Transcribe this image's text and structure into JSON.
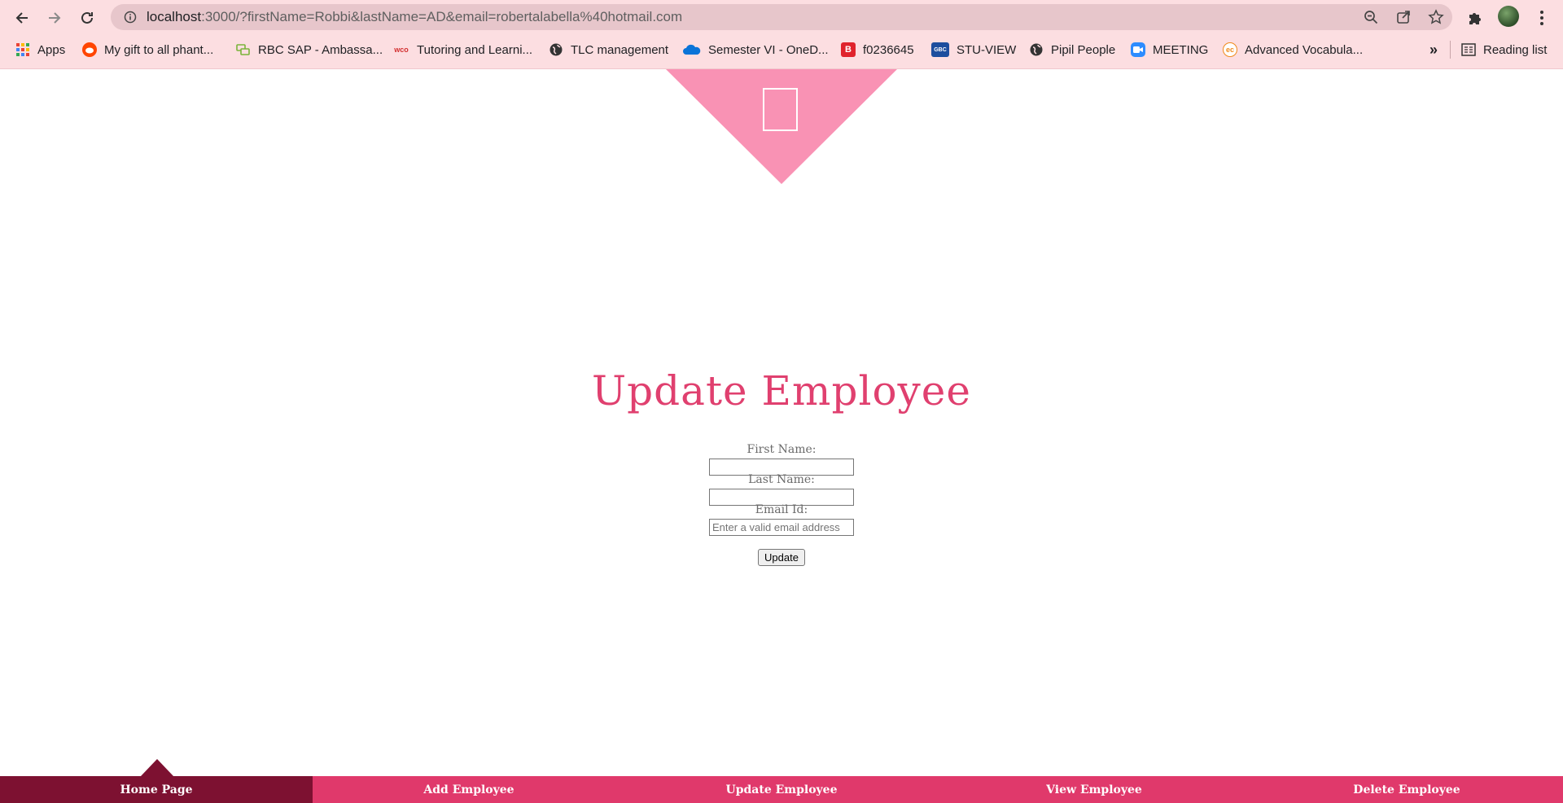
{
  "browser": {
    "url_host": "localhost",
    "url_rest": ":3000/?firstName=Robbi&lastName=AD&email=robertalabella%40hotmail.com",
    "bookmarks": [
      {
        "label": "Apps",
        "icon": "apps-grid-icon"
      },
      {
        "label": "My gift to all phant...",
        "icon": "reddit-icon"
      },
      {
        "label": "RBC SAP - Ambassa...",
        "icon": "chat-icon"
      },
      {
        "label": "Tutoring and Learni...",
        "icon": "wco-icon",
        "icon_text": "wco"
      },
      {
        "label": "TLC management",
        "icon": "globe-icon"
      },
      {
        "label": "Semester VI - OneD...",
        "icon": "onedrive-icon"
      },
      {
        "label": "f0236645",
        "icon": "b-icon",
        "icon_text": "B"
      },
      {
        "label": "STU-VIEW",
        "icon": "gbc-icon",
        "icon_text": "GBC"
      },
      {
        "label": "Pipil People",
        "icon": "globe-icon"
      },
      {
        "label": "MEETING",
        "icon": "zoom-icon"
      },
      {
        "label": "Advanced Vocabula...",
        "icon": "ec-icon",
        "icon_text": "ec"
      }
    ],
    "overflow_label": "»",
    "reading_list_label": "Reading list"
  },
  "page": {
    "title": "Update Employee",
    "form": {
      "first_name_label": "First Name:",
      "first_name_value": "",
      "last_name_label": "Last Name:",
      "last_name_value": "",
      "email_label": "Email Id:",
      "email_placeholder": "Enter a valid email address",
      "submit_label": "Update"
    }
  },
  "footer_nav": {
    "items": [
      {
        "label": "Home Page",
        "active": true
      },
      {
        "label": "Add Employee",
        "active": false
      },
      {
        "label": "Update Employee",
        "active": false
      },
      {
        "label": "View Employee",
        "active": false
      },
      {
        "label": "Delete Employee",
        "active": false
      }
    ]
  },
  "colors": {
    "chrome_bg": "#fcdee1",
    "omnibox_bg": "#e7c6cb",
    "triangle": "#f992b4",
    "title": "#e0406f",
    "nav_bg": "#e0396b",
    "nav_active": "#7d1131"
  }
}
